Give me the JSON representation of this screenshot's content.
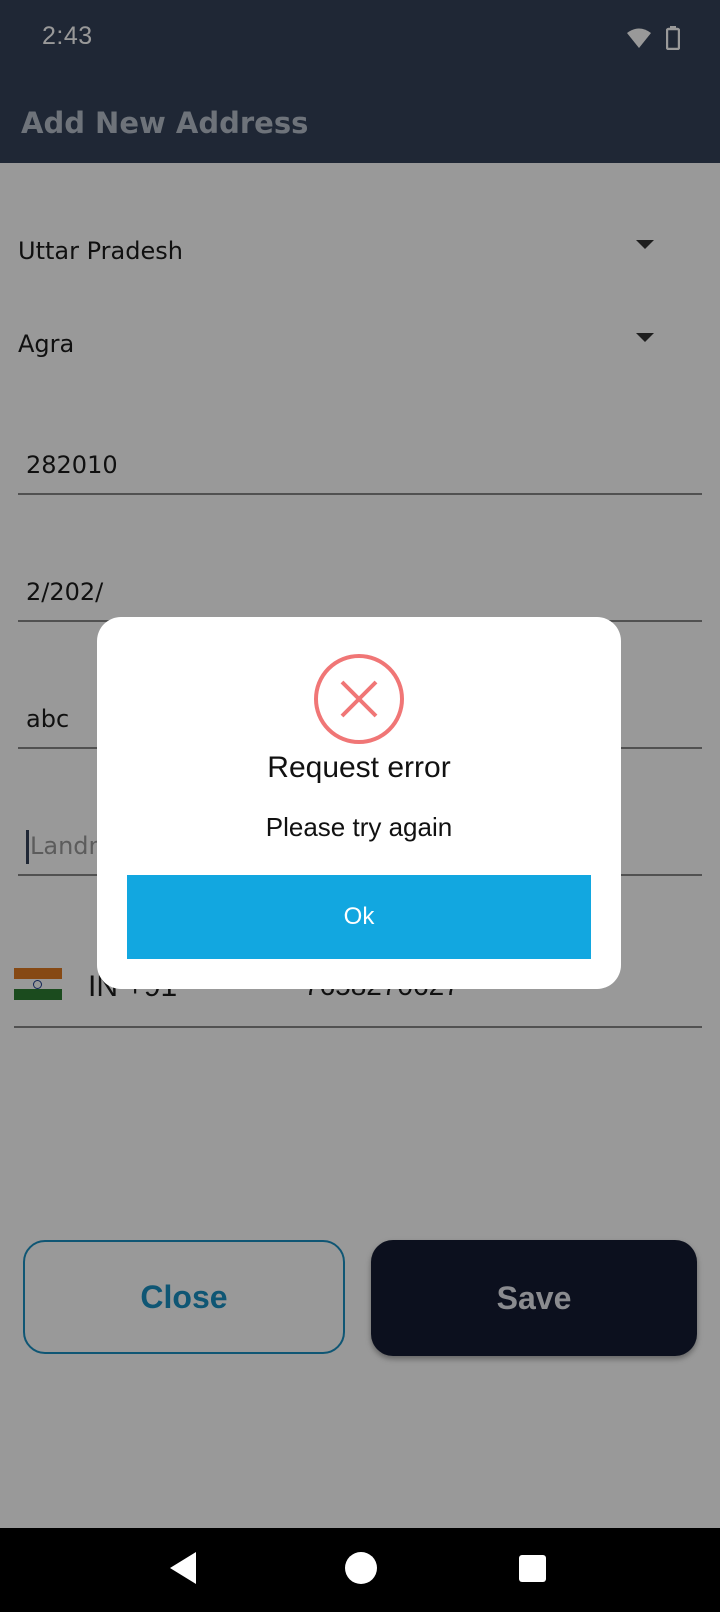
{
  "status_bar": {
    "time": "2:43"
  },
  "app_bar": {
    "title": "Add New Address"
  },
  "form": {
    "state": "Uttar Pradesh",
    "city": "Agra",
    "pincode": "282010",
    "address_line": "2/202/",
    "area": "abc",
    "landmark_placeholder": "Landmark",
    "phone": {
      "country_code": "IN +91",
      "number": "7658270627"
    }
  },
  "buttons": {
    "close_label": "Close",
    "save_label": "Save"
  },
  "dialog": {
    "title": "Request error",
    "message": "Please try again",
    "ok_label": "Ok"
  },
  "colors": {
    "app_bar": "#344259",
    "dialog_button": "#12a7e0",
    "error_icon": "#f07676",
    "save_button": "#141b32",
    "close_border": "#1a8fc2"
  },
  "icons": [
    "wifi-icon",
    "battery-icon",
    "dropdown-caret-icon",
    "india-flag-icon",
    "error-x-icon",
    "nav-back-icon",
    "nav-home-icon",
    "nav-recent-icon"
  ]
}
